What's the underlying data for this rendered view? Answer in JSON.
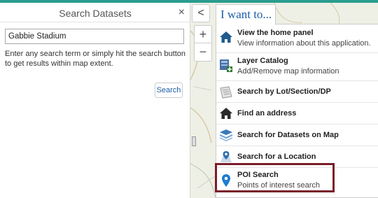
{
  "panel": {
    "title": "Search Datasets",
    "close_glyph": "×",
    "search_value": "Gabbie Stadium",
    "help_text": "Enter any search term or simply hit the search button to get results within map extent.",
    "search_button": "Search"
  },
  "map_controls": {
    "collapse_glyph": "<",
    "zoom_in_glyph": "+",
    "zoom_out_glyph": "−"
  },
  "i_want_to": {
    "label": "I want to...",
    "items": [
      {
        "title": "View the home panel",
        "subtitle": "View information about this application.",
        "icon": "home-icon"
      },
      {
        "title": "Layer Catalog",
        "subtitle": "Add/Remove map information",
        "icon": "layer-catalog-icon"
      },
      {
        "title": "Search by Lot/Section/DP",
        "subtitle": "",
        "icon": "parcel-search-icon"
      },
      {
        "title": "Find an address",
        "subtitle": "",
        "icon": "house-icon"
      },
      {
        "title": "Search for Datasets on Map",
        "subtitle": "",
        "icon": "layers-icon"
      },
      {
        "title": "Search for a Location",
        "subtitle": "",
        "icon": "location-search-icon"
      },
      {
        "title": "POI Search",
        "subtitle": "Points of interest search",
        "icon": "map-pin-icon"
      }
    ]
  },
  "colors": {
    "accent_bar": "#2a9d8f",
    "link_blue": "#1f5fa8",
    "highlight_border": "#7b1d2a"
  }
}
